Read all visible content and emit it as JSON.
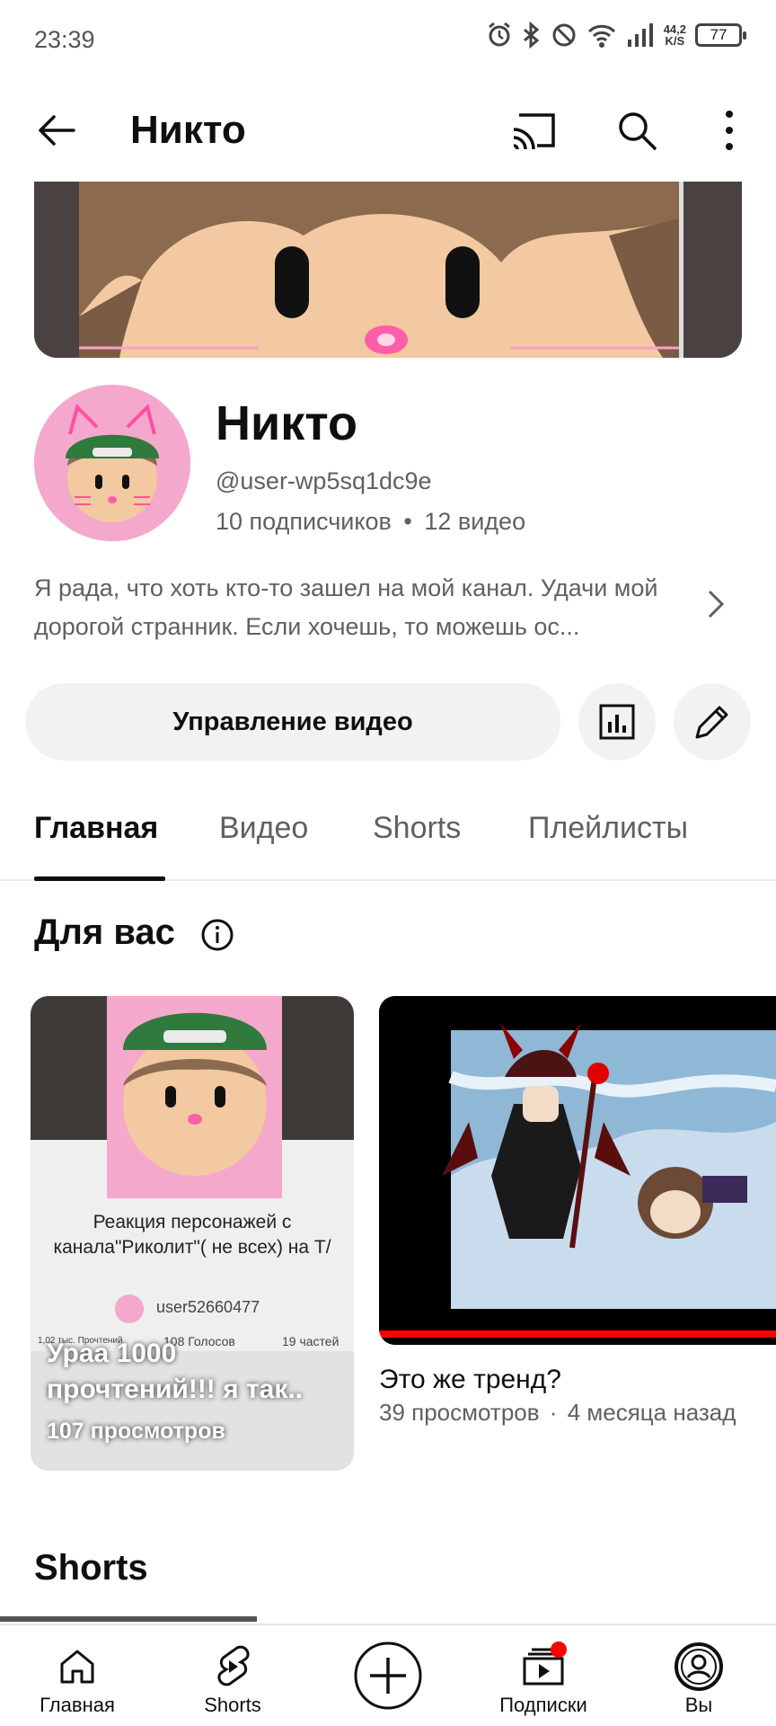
{
  "status_bar": {
    "time": "23:39",
    "net_speed_value": "44,2",
    "net_speed_unit": "K/S",
    "battery": "77",
    "icons": [
      "alarm-icon",
      "bluetooth-icon",
      "dnd-icon",
      "wifi-icon",
      "signal-icon"
    ]
  },
  "top_bar": {
    "title": "Никто",
    "icons": [
      "back-arrow-icon",
      "cast-icon",
      "search-icon",
      "more-vert-icon"
    ]
  },
  "channel": {
    "name": "Никто",
    "handle": "@user-wp5sq1dc9e",
    "subscribers": "10 подписчиков",
    "separator": "•",
    "videos": "12 видео",
    "description": "Я рада, что хоть кто-то зашел на мой канал. Удачи мой дорогой странник. Если хочешь, то можешь ос..."
  },
  "actions": {
    "manage_label": "Управление видео",
    "icons": [
      "analytics-icon",
      "edit-pencil-icon"
    ]
  },
  "tabs": [
    {
      "label": "Главная",
      "active": true
    },
    {
      "label": "Видео",
      "active": false
    },
    {
      "label": "Shorts",
      "active": false
    },
    {
      "label": "Плейлисты",
      "active": false
    }
  ],
  "for_you": {
    "title": "Для вас",
    "cards": [
      {
        "title": "Ураа 1000 прочтений!!! я так..",
        "views": "107 просмотров",
        "thumb_text": {
          "line1": "Реакция персонажей с",
          "line2": "канала\"Риколит\"( не всех) на Т/",
          "user": "user52660477",
          "reads": "1,02 тыс. Прочтений",
          "votes": "108 Голосов",
          "parts": "19 частей"
        }
      },
      {
        "title": "Это же тренд?",
        "views": "39 просмотров",
        "separator": "·",
        "age": "4 месяца назад"
      }
    ]
  },
  "shorts_section": {
    "title": "Shorts"
  },
  "bottom_nav": [
    {
      "label": "Главная",
      "icon": "home-icon"
    },
    {
      "label": "Shorts",
      "icon": "shorts-icon"
    },
    {
      "label": "",
      "icon": "create-plus-icon"
    },
    {
      "label": "Подписки",
      "icon": "subscriptions-icon",
      "badge": true
    },
    {
      "label": "Вы",
      "icon": "you-avatar-icon"
    }
  ],
  "colors": {
    "accent_red": "#ff0000",
    "text_primary": "#0f0f0f",
    "text_secondary": "#606060",
    "chip_bg": "#f2f2f2",
    "avatar_bg": "#f4a8cc"
  }
}
